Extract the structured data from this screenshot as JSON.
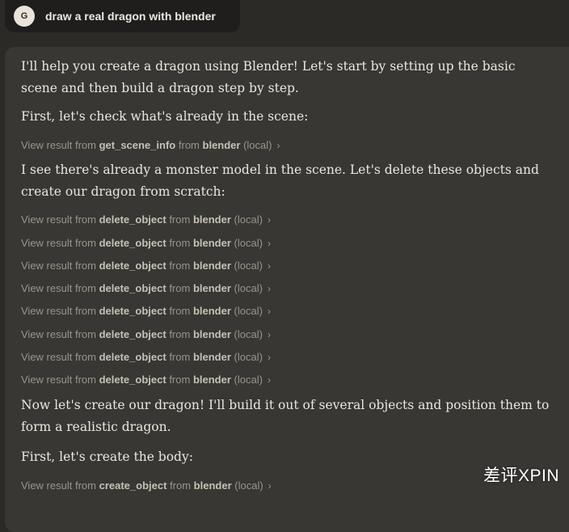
{
  "user_message": {
    "avatar_initial": "G",
    "text": "draw a real dragon with blender"
  },
  "response": {
    "para1": "I'll help you create a dragon using Blender! Let's start by setting up the basic scene and then build a dragon step by step.",
    "para2": "First, let's check what's already in the scene:",
    "para3": "I see there's already a monster model in the scene. Let's delete these objects and create our dragon from scratch:",
    "para4": "Now let's create our dragon! I'll build it out of several objects and position them to form a realistic dragon.",
    "para5": "First, let's create the body:",
    "tool_results": [
      {
        "prefix": "View result from",
        "tool": "get_scene_info",
        "mid": "from",
        "server": "blender",
        "suffix": "(local)"
      },
      {
        "prefix": "View result from",
        "tool": "delete_object",
        "mid": "from",
        "server": "blender",
        "suffix": "(local)"
      },
      {
        "prefix": "View result from",
        "tool": "delete_object",
        "mid": "from",
        "server": "blender",
        "suffix": "(local)"
      },
      {
        "prefix": "View result from",
        "tool": "delete_object",
        "mid": "from",
        "server": "blender",
        "suffix": "(local)"
      },
      {
        "prefix": "View result from",
        "tool": "delete_object",
        "mid": "from",
        "server": "blender",
        "suffix": "(local)"
      },
      {
        "prefix": "View result from",
        "tool": "delete_object",
        "mid": "from",
        "server": "blender",
        "suffix": "(local)"
      },
      {
        "prefix": "View result from",
        "tool": "delete_object",
        "mid": "from",
        "server": "blender",
        "suffix": "(local)"
      },
      {
        "prefix": "View result from",
        "tool": "delete_object",
        "mid": "from",
        "server": "blender",
        "suffix": "(local)"
      },
      {
        "prefix": "View result from",
        "tool": "delete_object",
        "mid": "from",
        "server": "blender",
        "suffix": "(local)"
      },
      {
        "prefix": "View result from",
        "tool": "create_object",
        "mid": "from",
        "server": "blender",
        "suffix": "(local)"
      }
    ]
  },
  "watermark": "差评XPIN"
}
